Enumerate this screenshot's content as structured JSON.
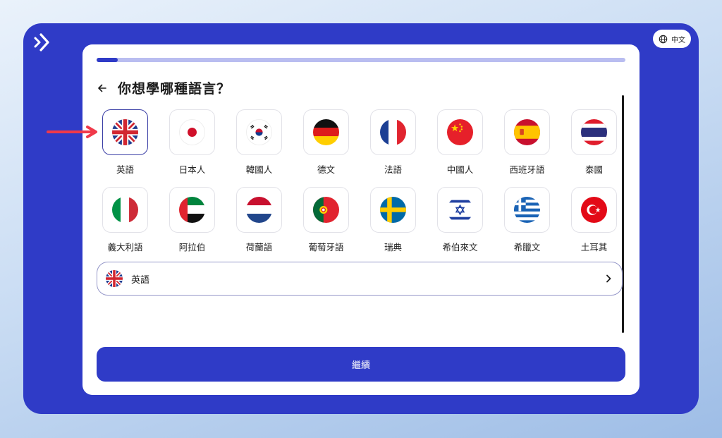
{
  "app": {
    "interface_language": "中文"
  },
  "progress": {
    "fraction": 0.04
  },
  "header": {
    "title": "你想學哪種語言？"
  },
  "languages": [
    {
      "label": "英語",
      "flag": "uk-flag-icon",
      "selected": true
    },
    {
      "label": "日本人",
      "flag": "japan-flag-icon",
      "selected": false
    },
    {
      "label": "韓國人",
      "flag": "korea-flag-icon",
      "selected": false
    },
    {
      "label": "德文",
      "flag": "germany-flag-icon",
      "selected": false
    },
    {
      "label": "法語",
      "flag": "france-flag-icon",
      "selected": false
    },
    {
      "label": "中國人",
      "flag": "china-flag-icon",
      "selected": false
    },
    {
      "label": "西班牙語",
      "flag": "spain-flag-icon",
      "selected": false
    },
    {
      "label": "泰國",
      "flag": "thailand-flag-icon",
      "selected": false
    },
    {
      "label": "義大利語",
      "flag": "italy-flag-icon",
      "selected": false
    },
    {
      "label": "阿拉伯",
      "flag": "uae-flag-icon",
      "selected": false
    },
    {
      "label": "荷蘭語",
      "flag": "netherlands-flag-icon",
      "selected": false
    },
    {
      "label": "葡萄牙語",
      "flag": "portugal-flag-icon",
      "selected": false
    },
    {
      "label": "瑞典",
      "flag": "sweden-flag-icon",
      "selected": false
    },
    {
      "label": "希伯來文",
      "flag": "israel-flag-icon",
      "selected": false
    },
    {
      "label": "希臘文",
      "flag": "greece-flag-icon",
      "selected": false
    },
    {
      "label": "土耳其",
      "flag": "turkey-flag-icon",
      "selected": false
    }
  ],
  "selected_language": {
    "label": "英語",
    "flag": "uk-flag-icon"
  },
  "continue_label": "繼續",
  "colors": {
    "brand": "#2f3bc7",
    "annotation_arrow": "#f0394a"
  }
}
